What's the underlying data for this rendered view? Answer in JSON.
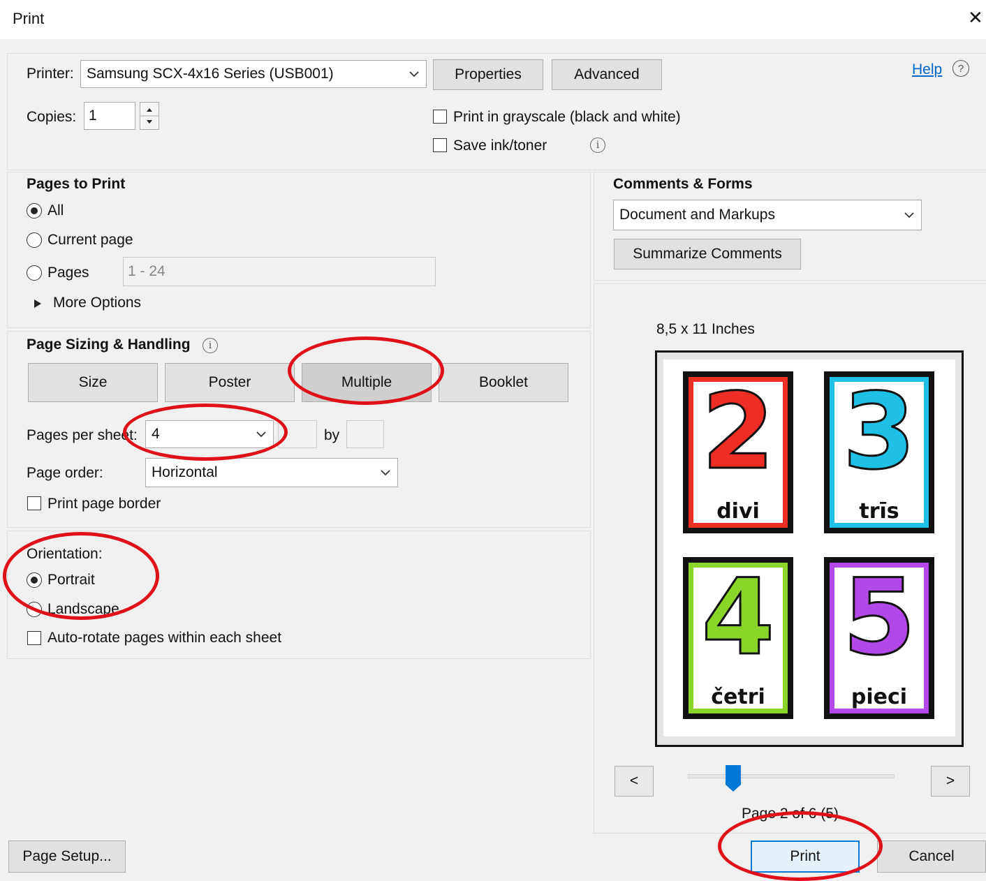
{
  "window": {
    "title": "Print",
    "close_glyph": "✕"
  },
  "printer": {
    "label": "Printer:",
    "value": "Samsung SCX-4x16 Series (USB001)",
    "properties_label": "Properties",
    "advanced_label": "Advanced"
  },
  "help": {
    "label": "Help",
    "icon": "question-circle-icon"
  },
  "copies": {
    "label": "Copies:",
    "value": "1"
  },
  "options": {
    "grayscale_label": "Print in grayscale (black and white)",
    "save_ink_label": "Save ink/toner"
  },
  "pages_to_print": {
    "heading": "Pages to Print",
    "all_label": "All",
    "current_label": "Current page",
    "pages_label": "Pages",
    "pages_value": "1 - 24",
    "more_options_label": "More Options"
  },
  "sizing": {
    "heading": "Page Sizing & Handling",
    "buttons": [
      "Size",
      "Poster",
      "Multiple",
      "Booklet"
    ],
    "pages_per_sheet_label": "Pages per sheet:",
    "pages_per_sheet_value": "4",
    "by_label": "by",
    "page_order_label": "Page order:",
    "page_order_value": "Horizontal",
    "border_label": "Print page border"
  },
  "orientation": {
    "heading": "Orientation:",
    "portrait_label": "Portrait",
    "landscape_label": "Landscape",
    "autorotate_label": "Auto-rotate pages within each sheet"
  },
  "comments": {
    "heading": "Comments & Forms",
    "value": "Document and Markups",
    "summarize_label": "Summarize Comments"
  },
  "preview": {
    "size_label": "8,5 x 11 Inches",
    "cards": [
      {
        "number": "2",
        "word": "divi",
        "color": "#ee2d24"
      },
      {
        "number": "3",
        "word": "trīs",
        "color": "#1fc0e6"
      },
      {
        "number": "4",
        "word": "četri",
        "color": "#8bd42a"
      },
      {
        "number": "5",
        "word": "pieci",
        "color": "#b348e8"
      }
    ],
    "prev_label": "<",
    "next_label": ">",
    "page_status": "Page 2 of 6 (5)",
    "slider_fraction": 0.22
  },
  "footer": {
    "page_setup_label": "Page Setup...",
    "print_label": "Print",
    "cancel_label": "Cancel"
  },
  "colors": {
    "annotation_red": "#e0101a",
    "accent_blue": "#0078d7",
    "link_blue": "#0066cc"
  }
}
